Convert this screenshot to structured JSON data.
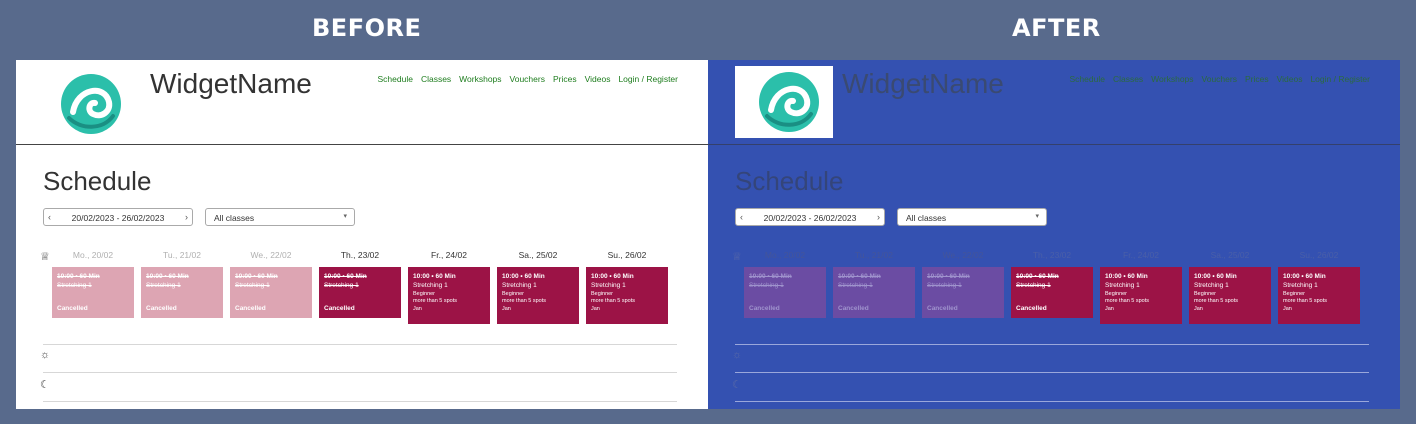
{
  "labels": {
    "before": "BEFORE",
    "after": "AFTER"
  },
  "widget": {
    "name": "WidgetName",
    "nav": [
      "Schedule",
      "Classes",
      "Workshops",
      "Vouchers",
      "Prices",
      "Videos",
      "Login / Register"
    ]
  },
  "schedule": {
    "title": "Schedule",
    "date_range": "20/02/2023 - 26/02/2023",
    "prev_icon": "chevron-left-icon",
    "next_icon": "chevron-right-icon",
    "filter": "All classes",
    "days": [
      "Mo., 20/02",
      "Tu., 21/02",
      "We., 22/02",
      "Th., 23/02",
      "Fr., 24/02",
      "Sa., 25/02",
      "Su., 26/02"
    ],
    "row_icons": [
      "crown-icon",
      "sun-icon",
      "moon-icon"
    ],
    "cards": [
      {
        "time": "10:00 • 60 Min",
        "name": "Stretching 1",
        "status": "Cancelled",
        "state": "past"
      },
      {
        "time": "10:00 • 60 Min",
        "name": "Stretching 1",
        "status": "Cancelled",
        "state": "past"
      },
      {
        "time": "10:00 • 60 Min",
        "name": "Stretching 1",
        "status": "Cancelled",
        "state": "past"
      },
      {
        "time": "10:00 • 60 Min",
        "name": "Stretching 1",
        "status": "Cancelled",
        "state": "today"
      },
      {
        "time": "10:00 • 60 Min",
        "name": "Stretching 1",
        "level": "Beginner",
        "spots": "more than 5 spots",
        "teacher": "Jan",
        "state": "future"
      },
      {
        "time": "10:00 • 60 Min",
        "name": "Stretching 1",
        "level": "Beginner",
        "spots": "more than 5 spots",
        "teacher": "Jan",
        "state": "future"
      },
      {
        "time": "10:00 • 60 Min",
        "name": "Stretching 1",
        "level": "Beginner",
        "spots": "more than 5 spots",
        "teacher": "Jan",
        "state": "future"
      }
    ]
  },
  "colors": {
    "background": "#586a8c",
    "after_overlay": "#3451b1",
    "card_active": "#9c1346",
    "card_past": "#dda5b3",
    "nav_link": "#1e7d1e",
    "logo_teal": "#2bbfaa"
  }
}
